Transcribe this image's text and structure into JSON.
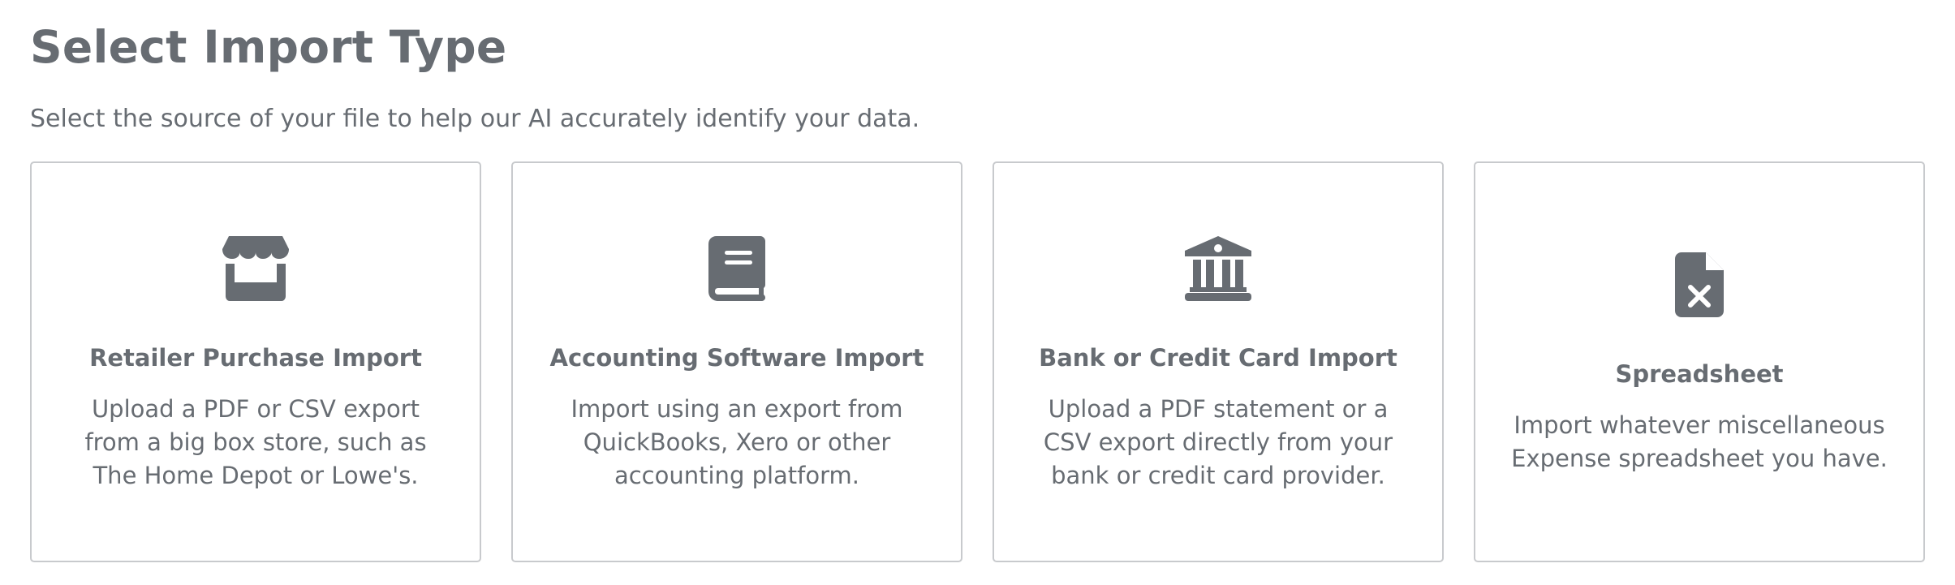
{
  "header": {
    "title": "Select Import Type",
    "subtitle": "Select the source of your file to help our AI accurately identify your data."
  },
  "cards": [
    {
      "icon": "store-icon",
      "title": "Retailer Purchase Import",
      "description": "Upload a PDF or CSV export from a big box store, such as The Home Depot or Lowe's."
    },
    {
      "icon": "book-icon",
      "title": "Accounting Software Import",
      "description": "Import using an export from QuickBooks, Xero or other accounting platform."
    },
    {
      "icon": "bank-icon",
      "title": "Bank or Credit Card Import",
      "description": "Upload a PDF statement or a CSV export directly from your bank or credit card provider."
    },
    {
      "icon": "spreadsheet-file-icon",
      "title": "Spreadsheet",
      "description": "Import whatever miscellaneous Expense spreadsheet you have."
    }
  ],
  "colors": {
    "text": "#676c72",
    "icon": "#676c72",
    "card_border": "#c8cacd",
    "background": "#ffffff"
  }
}
